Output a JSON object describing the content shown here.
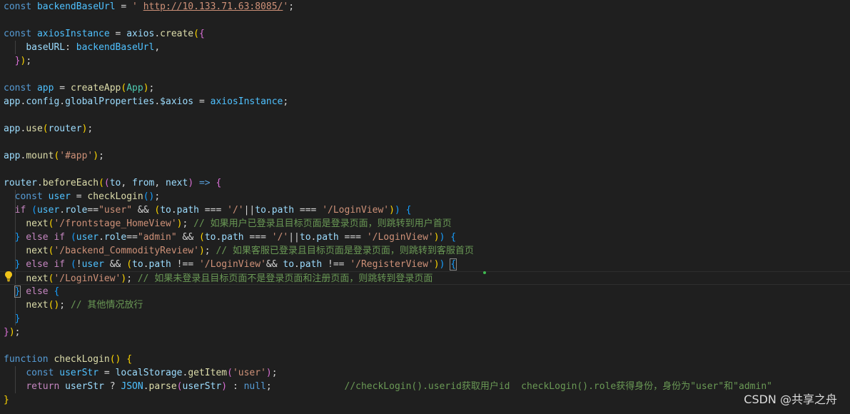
{
  "editor": {
    "watermark": "CSDN @共享之舟",
    "lightbulb": "lightbulb-icon",
    "lines": [
      [
        [
          "kw",
          "const "
        ],
        [
          "const",
          "backendBaseUrl"
        ],
        [
          "plain",
          " = "
        ],
        [
          "str",
          "' "
        ],
        [
          "str url",
          "http://10.133.71.63:8085/"
        ],
        [
          "str",
          "'"
        ],
        [
          "plain",
          ";"
        ]
      ],
      [],
      [
        [
          "kw",
          "const "
        ],
        [
          "const",
          "axiosInstance"
        ],
        [
          "plain",
          " = "
        ],
        [
          "var",
          "axios"
        ],
        [
          "plain",
          "."
        ],
        [
          "fn",
          "create"
        ],
        [
          "br1",
          "("
        ],
        [
          "br2",
          "{"
        ]
      ],
      [
        [
          "plain",
          "    "
        ],
        [
          "var",
          "baseURL"
        ],
        [
          "plain",
          ": "
        ],
        [
          "const",
          "backendBaseUrl"
        ],
        [
          "plain",
          ","
        ]
      ],
      [
        [
          "plain",
          "  "
        ],
        [
          "br2",
          "}"
        ],
        [
          "br1",
          ")"
        ],
        [
          "plain",
          ";"
        ]
      ],
      [],
      [
        [
          "kw",
          "const "
        ],
        [
          "const",
          "app"
        ],
        [
          "plain",
          " = "
        ],
        [
          "fn",
          "createApp"
        ],
        [
          "br1",
          "("
        ],
        [
          "cls",
          "App"
        ],
        [
          "br1",
          ")"
        ],
        [
          "plain",
          ";"
        ]
      ],
      [
        [
          "var",
          "app"
        ],
        [
          "plain",
          "."
        ],
        [
          "var",
          "config"
        ],
        [
          "plain",
          "."
        ],
        [
          "var",
          "globalProperties"
        ],
        [
          "plain",
          "."
        ],
        [
          "var",
          "$axios"
        ],
        [
          "plain",
          " = "
        ],
        [
          "const",
          "axiosInstance"
        ],
        [
          "plain",
          ";"
        ]
      ],
      [],
      [
        [
          "var",
          "app"
        ],
        [
          "plain",
          "."
        ],
        [
          "fn",
          "use"
        ],
        [
          "br1",
          "("
        ],
        [
          "var",
          "router"
        ],
        [
          "br1",
          ")"
        ],
        [
          "plain",
          ";"
        ]
      ],
      [],
      [
        [
          "var",
          "app"
        ],
        [
          "plain",
          "."
        ],
        [
          "fn",
          "mount"
        ],
        [
          "br1",
          "("
        ],
        [
          "str",
          "'#app'"
        ],
        [
          "br1",
          ")"
        ],
        [
          "plain",
          ";"
        ]
      ],
      [],
      [
        [
          "var",
          "router"
        ],
        [
          "plain",
          "."
        ],
        [
          "fn",
          "beforeEach"
        ],
        [
          "br1",
          "("
        ],
        [
          "br2",
          "("
        ],
        [
          "var",
          "to"
        ],
        [
          "plain",
          ", "
        ],
        [
          "var",
          "from"
        ],
        [
          "plain",
          ", "
        ],
        [
          "var",
          "next"
        ],
        [
          "br2",
          ")"
        ],
        [
          "kw",
          " => "
        ],
        [
          "br2",
          "{"
        ]
      ],
      [
        [
          "plain",
          "  "
        ],
        [
          "kw",
          "const "
        ],
        [
          "const",
          "user"
        ],
        [
          "plain",
          " = "
        ],
        [
          "fn",
          "checkLogin"
        ],
        [
          "br3",
          "()"
        ],
        [
          "plain",
          ";"
        ]
      ],
      [
        [
          "plain",
          "  "
        ],
        [
          "ctrl",
          "if "
        ],
        [
          "br3",
          "("
        ],
        [
          "const",
          "user"
        ],
        [
          "plain",
          "."
        ],
        [
          "var",
          "role"
        ],
        [
          "plain",
          "=="
        ],
        [
          "str",
          "\"user\""
        ],
        [
          "plain",
          " && "
        ],
        [
          "br1",
          "("
        ],
        [
          "var",
          "to"
        ],
        [
          "plain",
          "."
        ],
        [
          "var",
          "path"
        ],
        [
          "plain",
          " === "
        ],
        [
          "str",
          "'/'"
        ],
        [
          "plain",
          "||"
        ],
        [
          "var",
          "to"
        ],
        [
          "plain",
          "."
        ],
        [
          "var",
          "path"
        ],
        [
          "plain",
          " === "
        ],
        [
          "str",
          "'/LoginView'"
        ],
        [
          "br1",
          ")"
        ],
        [
          "br3",
          ")"
        ],
        [
          "plain",
          " "
        ],
        [
          "br3",
          "{"
        ]
      ],
      [
        [
          "plain",
          "    "
        ],
        [
          "fn",
          "next"
        ],
        [
          "br1",
          "("
        ],
        [
          "str",
          "'/frontstage_HomeView'"
        ],
        [
          "br1",
          ")"
        ],
        [
          "plain",
          "; "
        ],
        [
          "cmt",
          "// 如果用户已登录且目标页面是登录页面，则跳转到用户首页"
        ]
      ],
      [
        [
          "plain",
          "  "
        ],
        [
          "br3",
          "}"
        ],
        [
          "ctrl",
          " else if "
        ],
        [
          "br3",
          "("
        ],
        [
          "const",
          "user"
        ],
        [
          "plain",
          "."
        ],
        [
          "var",
          "role"
        ],
        [
          "plain",
          "=="
        ],
        [
          "str",
          "\"admin\""
        ],
        [
          "plain",
          " && "
        ],
        [
          "br1",
          "("
        ],
        [
          "var",
          "to"
        ],
        [
          "plain",
          "."
        ],
        [
          "var",
          "path"
        ],
        [
          "plain",
          " === "
        ],
        [
          "str",
          "'/'"
        ],
        [
          "plain",
          "||"
        ],
        [
          "var",
          "to"
        ],
        [
          "plain",
          "."
        ],
        [
          "var",
          "path"
        ],
        [
          "plain",
          " === "
        ],
        [
          "str",
          "'/LoginView'"
        ],
        [
          "br1",
          ")"
        ],
        [
          "br3",
          ")"
        ],
        [
          "plain",
          " "
        ],
        [
          "br3",
          "{"
        ]
      ],
      [
        [
          "plain",
          "    "
        ],
        [
          "fn",
          "next"
        ],
        [
          "br1",
          "("
        ],
        [
          "str",
          "'/backend_CommodityReview'"
        ],
        [
          "br1",
          ")"
        ],
        [
          "plain",
          "; "
        ],
        [
          "cmt",
          "// 如果客服已登录且目标页面是登录页面，则跳转到客服首页"
        ]
      ],
      [
        [
          "plain",
          "  "
        ],
        [
          "br3",
          "}"
        ],
        [
          "ctrl",
          " else if "
        ],
        [
          "br3",
          "("
        ],
        [
          "plain",
          "!"
        ],
        [
          "const",
          "user"
        ],
        [
          "plain",
          " && "
        ],
        [
          "br1",
          "("
        ],
        [
          "var",
          "to"
        ],
        [
          "plain",
          "."
        ],
        [
          "var",
          "path"
        ],
        [
          "plain",
          " !== "
        ],
        [
          "str",
          "'/LoginView'"
        ],
        [
          "plain",
          "&& "
        ],
        [
          "var",
          "to"
        ],
        [
          "plain",
          "."
        ],
        [
          "var",
          "path"
        ],
        [
          "plain",
          " !== "
        ],
        [
          "str",
          "'/RegisterView'"
        ],
        [
          "br1",
          ")"
        ],
        [
          "br3",
          ")"
        ],
        [
          "plain",
          " "
        ],
        [
          "br3 box",
          "{"
        ]
      ],
      [
        [
          "plain",
          "    "
        ],
        [
          "fn",
          "next"
        ],
        [
          "br1",
          "("
        ],
        [
          "str",
          "'/LoginView'"
        ],
        [
          "br1",
          ")"
        ],
        [
          "plain",
          "; "
        ],
        [
          "cmt",
          "// 如果未登录且目标页面不是登录页面和注册页面，则跳转到登录页面"
        ]
      ],
      [
        [
          "plain",
          "  "
        ],
        [
          "br3 box",
          "}"
        ],
        [
          "ctrl",
          " else "
        ],
        [
          "br3",
          "{"
        ]
      ],
      [
        [
          "plain",
          "    "
        ],
        [
          "fn",
          "next"
        ],
        [
          "br1",
          "()"
        ],
        [
          "plain",
          "; "
        ],
        [
          "cmt",
          "// 其他情况放行"
        ]
      ],
      [
        [
          "plain",
          "  "
        ],
        [
          "br3",
          "}"
        ]
      ],
      [
        [
          "br2",
          "}"
        ],
        [
          "br1",
          ")"
        ],
        [
          "plain",
          ";"
        ]
      ],
      [],
      [
        [
          "kw",
          "function "
        ],
        [
          "fn",
          "checkLogin"
        ],
        [
          "br1",
          "()"
        ],
        [
          "plain",
          " "
        ],
        [
          "br1",
          "{"
        ]
      ],
      [
        [
          "plain",
          "    "
        ],
        [
          "kw",
          "const "
        ],
        [
          "const",
          "userStr"
        ],
        [
          "plain",
          " = "
        ],
        [
          "var",
          "localStorage"
        ],
        [
          "plain",
          "."
        ],
        [
          "fn",
          "getItem"
        ],
        [
          "br2",
          "("
        ],
        [
          "str",
          "'user'"
        ],
        [
          "br2",
          ")"
        ],
        [
          "plain",
          ";"
        ]
      ],
      [
        [
          "plain",
          "    "
        ],
        [
          "ctrl",
          "return "
        ],
        [
          "var",
          "userStr"
        ],
        [
          "plain",
          " ? "
        ],
        [
          "const",
          "JSON"
        ],
        [
          "plain",
          "."
        ],
        [
          "fn",
          "parse"
        ],
        [
          "br2",
          "("
        ],
        [
          "var",
          "userStr"
        ],
        [
          "br2",
          ")"
        ],
        [
          "plain",
          " : "
        ],
        [
          "kw",
          "null"
        ],
        [
          "plain",
          ";             "
        ],
        [
          "cmt",
          "//checkLogin().userid获取用户id  checkLogin().role获得身份，身份为\"user\"和\"admin\""
        ]
      ],
      [
        [
          "br1",
          "}"
        ]
      ]
    ]
  }
}
